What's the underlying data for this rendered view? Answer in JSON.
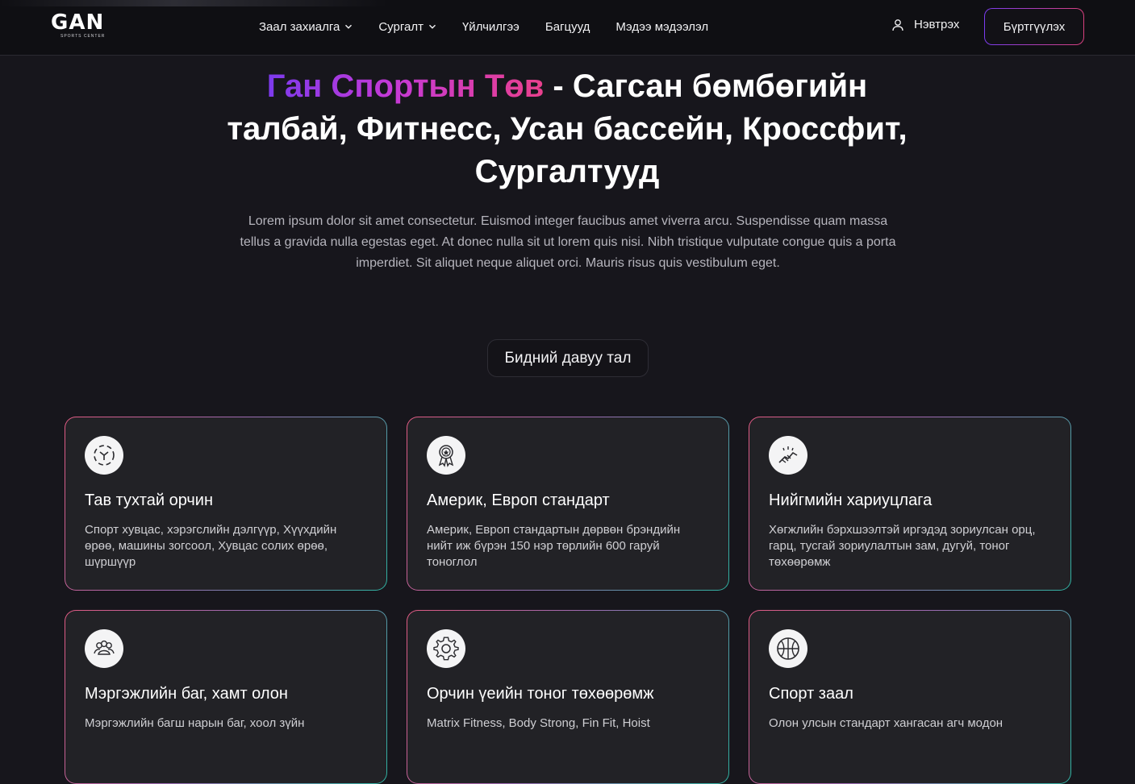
{
  "header": {
    "logo_text": "GAN",
    "logo_sub": "SPORTS CENTER",
    "nav": [
      {
        "label": "Заал захиалга",
        "has_dropdown": true
      },
      {
        "label": "Сургалт",
        "has_dropdown": true
      },
      {
        "label": "Үйлчилгээ",
        "has_dropdown": false
      },
      {
        "label": "Багцууд",
        "has_dropdown": false
      },
      {
        "label": "Мэдээ мэдээлэл",
        "has_dropdown": false
      }
    ],
    "login_label": "Нэвтрэх",
    "login_icon": "user-icon",
    "register_label": "Бүртгүүлэх"
  },
  "hero": {
    "brand": "Ган Спортын Төв",
    "title_rest": " - Сагсан бөмбөгийн талбай, Фитнесс, Усан бассейн, Кроссфит, Сургалтууд",
    "description": "Lorem ipsum dolor sit amet consectetur. Euismod integer faucibus amet viverra arcu. Suspendisse quam massa tellus a gravida nulla egestas eget. At donec nulla sit ut lorem quis nisi. Nibh tristique vulputate congue quis a porta imperdiet. Sit aliquet neque aliquet orci. Mauris risus quis vestibulum eget."
  },
  "advantages": {
    "pill_label": "Бидний давуу тал",
    "cards": [
      {
        "icon": "comfort-arrows-icon",
        "title": "Тав тухтай орчин",
        "text": "Спорт хувцас, хэрэгслийн дэлгүүр, Хүүхдийн өрөө, машины зогсоол, Хувцас солих өрөө, шүршүүр"
      },
      {
        "icon": "award-medal-icon",
        "title": "Америк, Европ стандарт",
        "text": "Америк, Европ стандартын дөрвөн брэндийн нийт иж бүрэн 150 нэр төрлийн 600 гаруй тоноглол"
      },
      {
        "icon": "handshake-icon",
        "title": "Нийгмийн хариуцлага",
        "text": "Хөгжлийн бэрхшээлтэй иргэдэд зориулсан орц, гарц, тусгай зориулалтын зам, дугуй, тоног төхөөрөмж"
      },
      {
        "icon": "team-icon",
        "title": "Мэргэжлийн баг, хамт олон",
        "text": "Мэргэжлийн багш нарын баг, хоол зүйн"
      },
      {
        "icon": "gear-icon",
        "title": "Орчин үеийн тоног төхөөрөмж",
        "text": "Matrix Fitness, Body Strong, Fin Fit, Hoist"
      },
      {
        "icon": "basketball-icon",
        "title": "Спорт заал",
        "text": "Олон улсын стандарт хангасан агч модон"
      }
    ]
  },
  "colors": {
    "background": "#17161c",
    "header_bg": "#0f0f13",
    "card_bg": "#222226",
    "brand_gradient": [
      "#7c3aed",
      "#c53ad6",
      "#e9408d"
    ],
    "card_border_gradient": [
      "#e15b83",
      "#9d6bb2",
      "#2fb3a2"
    ]
  }
}
